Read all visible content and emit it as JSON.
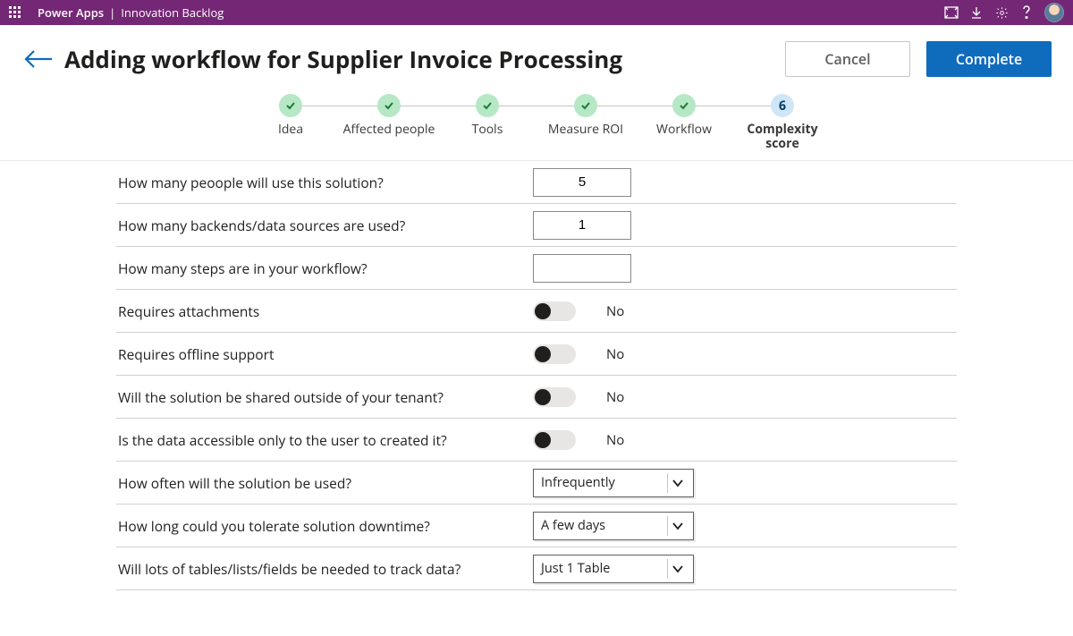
{
  "topbar": {
    "app_name": "Power Apps",
    "separator": "|",
    "page_name": "Innovation Backlog"
  },
  "header": {
    "title": "Adding workflow for Supplier Invoice Processing",
    "cancel": "Cancel",
    "complete": "Complete"
  },
  "stepper": {
    "items": [
      {
        "label": "Idea",
        "done": true
      },
      {
        "label": "Affected people",
        "done": true
      },
      {
        "label": "Tools",
        "done": true
      },
      {
        "label": "Measure ROI",
        "done": true
      },
      {
        "label": "Workflow",
        "done": true
      },
      {
        "label": "Complexity score",
        "done": false,
        "current": true,
        "number": "6"
      }
    ]
  },
  "form": {
    "rows": [
      {
        "type": "number",
        "question": "How many peoople will use this solution?",
        "value": "5"
      },
      {
        "type": "number",
        "question": "How many backends/data sources are  used?",
        "value": "1"
      },
      {
        "type": "number",
        "question": "How many steps are in your workflow?",
        "value": ""
      },
      {
        "type": "toggle",
        "question": "Requires attachments",
        "value": false,
        "value_label": "No"
      },
      {
        "type": "toggle",
        "question": "Requires offline support",
        "value": false,
        "value_label": "No"
      },
      {
        "type": "toggle",
        "question": "Will the solution be shared  outside of your tenant?",
        "value": false,
        "value_label": "No"
      },
      {
        "type": "toggle",
        "question": "Is the data accessible only to the user to created it?",
        "value": false,
        "value_label": "No"
      },
      {
        "type": "select",
        "question": "How often will the solution be used?",
        "value": "Infrequently"
      },
      {
        "type": "select",
        "question": "How long could you tolerate solution downtime?",
        "value": "A few days"
      },
      {
        "type": "select",
        "question": "Will lots of tables/lists/fields be needed to track data?",
        "value": "Just 1 Table"
      }
    ]
  }
}
